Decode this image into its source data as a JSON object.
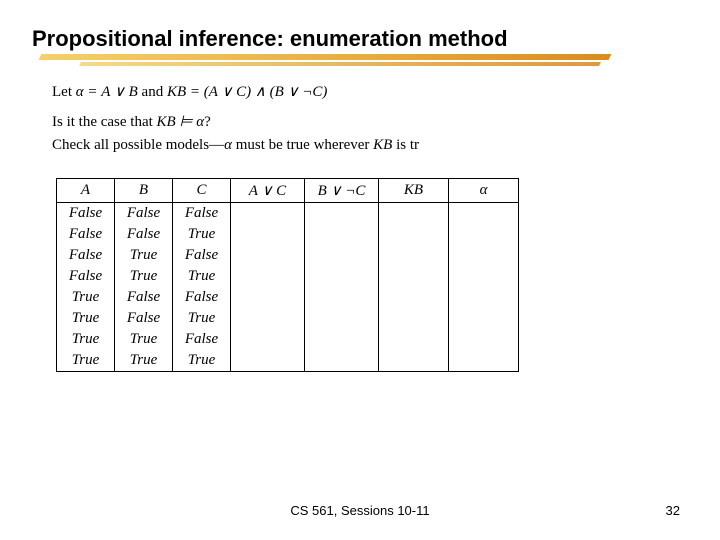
{
  "title": "Propositional inference: enumeration method",
  "line1_prefix": "Let ",
  "line1_math": "α = A ∨ B",
  "line1_mid": " and ",
  "line1_math2": "KB = (A ∨ C) ∧ (B ∨ ¬C)",
  "line2_prefix": "Is it the case that ",
  "line2_math": "KB ⊨ α",
  "line2_suffix": "?",
  "line3_prefix": "Check all possible models—",
  "line3_math": "α",
  "line3_mid": " must be true wherever ",
  "line3_math2": "KB",
  "line3_suffix": " is tr",
  "headers": [
    "A",
    "B",
    "C",
    "A ∨ C",
    "B ∨ ¬C",
    "KB",
    "α"
  ],
  "rows": [
    [
      "False",
      "False",
      "False",
      "",
      "",
      "",
      ""
    ],
    [
      "False",
      "False",
      "True",
      "",
      "",
      "",
      ""
    ],
    [
      "False",
      "True",
      "False",
      "",
      "",
      "",
      ""
    ],
    [
      "False",
      "True",
      "True",
      "",
      "",
      "",
      ""
    ],
    [
      "True",
      "False",
      "False",
      "",
      "",
      "",
      ""
    ],
    [
      "True",
      "False",
      "True",
      "",
      "",
      "",
      ""
    ],
    [
      "True",
      "True",
      "False",
      "",
      "",
      "",
      ""
    ],
    [
      "True",
      "True",
      "True",
      "",
      "",
      "",
      ""
    ]
  ],
  "footer": "CS 561,  Sessions 10-11",
  "pagenum": "32"
}
